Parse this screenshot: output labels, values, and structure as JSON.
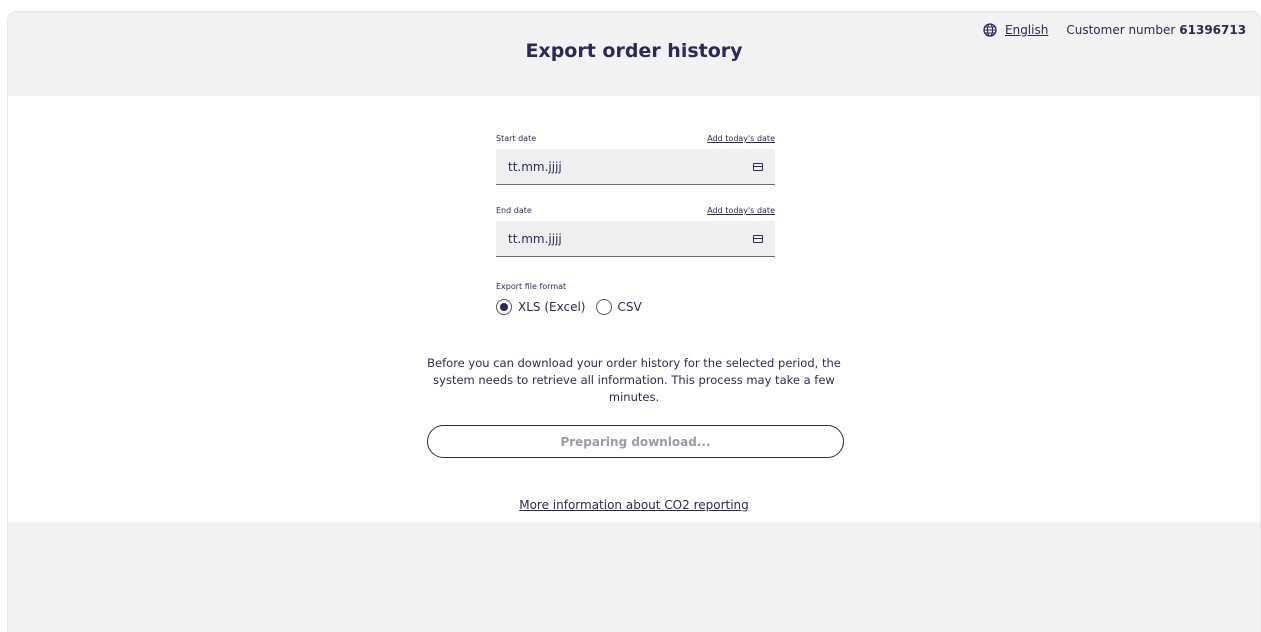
{
  "header": {
    "title": "Export order history",
    "language": "English",
    "customer_label": "Customer number",
    "customer_number": "61396713"
  },
  "form": {
    "start_date": {
      "label": "Start date",
      "today_link": "Add today's date",
      "placeholder": "tt.mm.jjjj"
    },
    "end_date": {
      "label": "End date",
      "today_link": "Add today's date",
      "placeholder": "tt.mm.jjjj"
    },
    "format": {
      "label": "Export file format",
      "options": [
        {
          "label": "XLS (Excel)",
          "selected": true
        },
        {
          "label": "CSV",
          "selected": false
        }
      ]
    },
    "info_text": "Before you can download your order history for the selected period, the system needs to retrieve all information. This process may take a few minutes.",
    "prepare_button": "Preparing download...",
    "co2_link": "More information about CO2 reporting"
  }
}
